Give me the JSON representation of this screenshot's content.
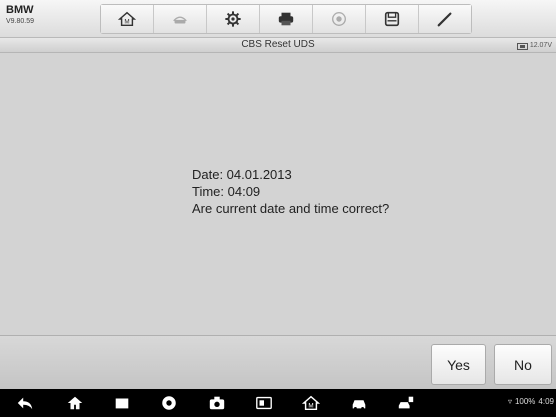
{
  "header": {
    "brand": "BMW",
    "version": "V9.80.59"
  },
  "toolbar": {
    "icons": [
      "home-icon",
      "vehicle-swap-icon",
      "settings-icon",
      "print-icon",
      "help-icon",
      "save-icon",
      "pen-icon"
    ]
  },
  "title": {
    "text": "CBS Reset UDS",
    "voltage": "12.07V"
  },
  "message": {
    "date": "Date: 04.01.2013",
    "time": "Time: 04:09",
    "question": "Are current date and time correct?"
  },
  "actions": {
    "yes": "Yes",
    "no": "No"
  },
  "status_bar": {
    "battery": "100%",
    "clock": "4:09"
  }
}
